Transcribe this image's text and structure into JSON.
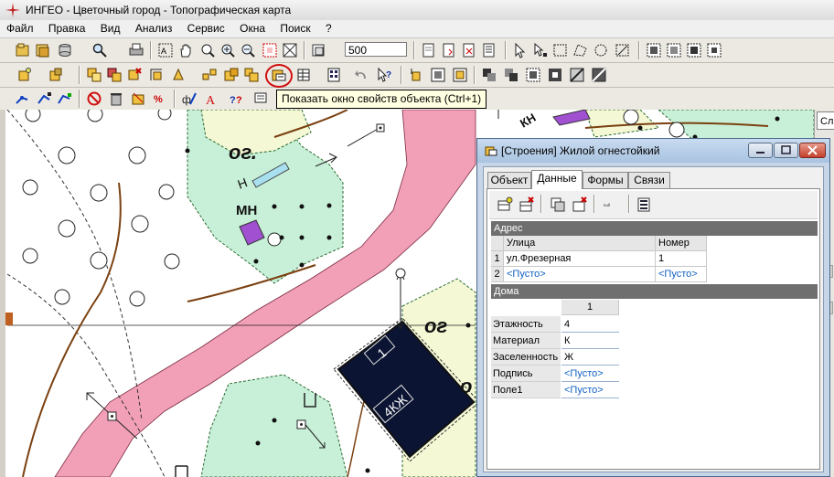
{
  "window": {
    "title": "ИНГЕО - Цветочный город - Топографическая карта"
  },
  "menu": [
    "Файл",
    "Правка",
    "Вид",
    "Анализ",
    "Сервис",
    "Окна",
    "Поиск",
    "?"
  ],
  "toolbar": {
    "zoom_value": "500"
  },
  "tooltip": "Показать окно свойств объекта (Ctrl+1)",
  "map": {
    "labels": {
      "og1": "ог.",
      "n": "Н",
      "mn": "МН",
      "og2": "ог",
      "kn": "КН",
      "o": "о",
      "num1": "1",
      "mat": "4КЖ"
    }
  },
  "side_panel": {
    "tab": "Сл"
  },
  "dialog": {
    "title": "[Строения] Жилой огнестойкий",
    "tabs": [
      "Объект",
      "Данные",
      "Формы",
      "Связи"
    ],
    "active_tab": "Данные",
    "address": {
      "section": "Адрес",
      "columns": [
        "Улица",
        "Номер"
      ],
      "rows": [
        {
          "n": "1",
          "street": "ул.Фрезерная",
          "number": "1"
        },
        {
          "n": "2",
          "street": "<Пусто>",
          "number": "<Пусто>"
        }
      ]
    },
    "houses": {
      "section": "Дома",
      "column": "1",
      "fields": [
        {
          "label": "Этажность",
          "value": "4"
        },
        {
          "label": "Материал",
          "value": "К"
        },
        {
          "label": "Заселенность",
          "value": "Ж"
        },
        {
          "label": "Подпись",
          "value": "<Пусто>"
        },
        {
          "label": "Поле1",
          "value": "<Пусто>"
        }
      ]
    }
  },
  "colors": {
    "road": "#f2a0b8",
    "greenzone": "#c8f0d8",
    "paleyellow": "#f4f8d4",
    "building": "#0b1432",
    "violet": "#a050d0",
    "accent": "#d01010"
  }
}
